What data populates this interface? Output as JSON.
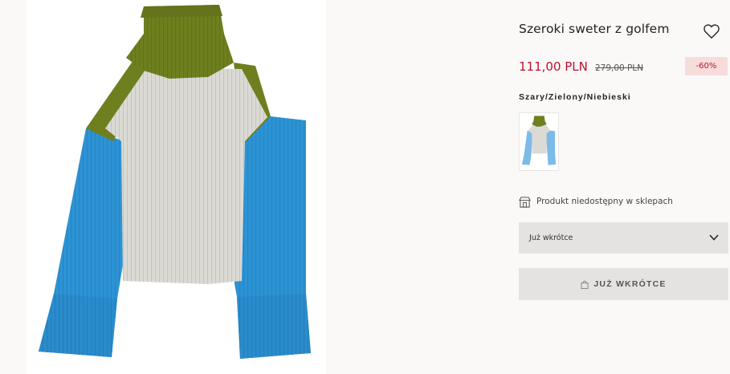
{
  "product": {
    "title": "Szeroki sweter z golfem",
    "price_current": "111,00 PLN",
    "price_original": "279,00 PLN",
    "discount": "-60%",
    "color_name": "Szary/Zielony/Niebieski",
    "store_availability": "Produkt niedostępny w sklepach"
  },
  "size_select": {
    "value": "Już wkrótce"
  },
  "add_button": {
    "label": "JUŻ WKRÓTCE"
  },
  "icons": {
    "favorite": "heart-icon",
    "store": "store-icon",
    "dropdown": "chevron-down-icon",
    "bag": "shopping-bag-icon"
  },
  "colors": {
    "price_red": "#c0112d",
    "discount_bg": "#f7dcdc",
    "control_bg": "#e4e3e1",
    "sweater_green": "#6e7f1f",
    "sweater_grey": "#dcdad4",
    "sweater_blue": "#2d93d5"
  }
}
